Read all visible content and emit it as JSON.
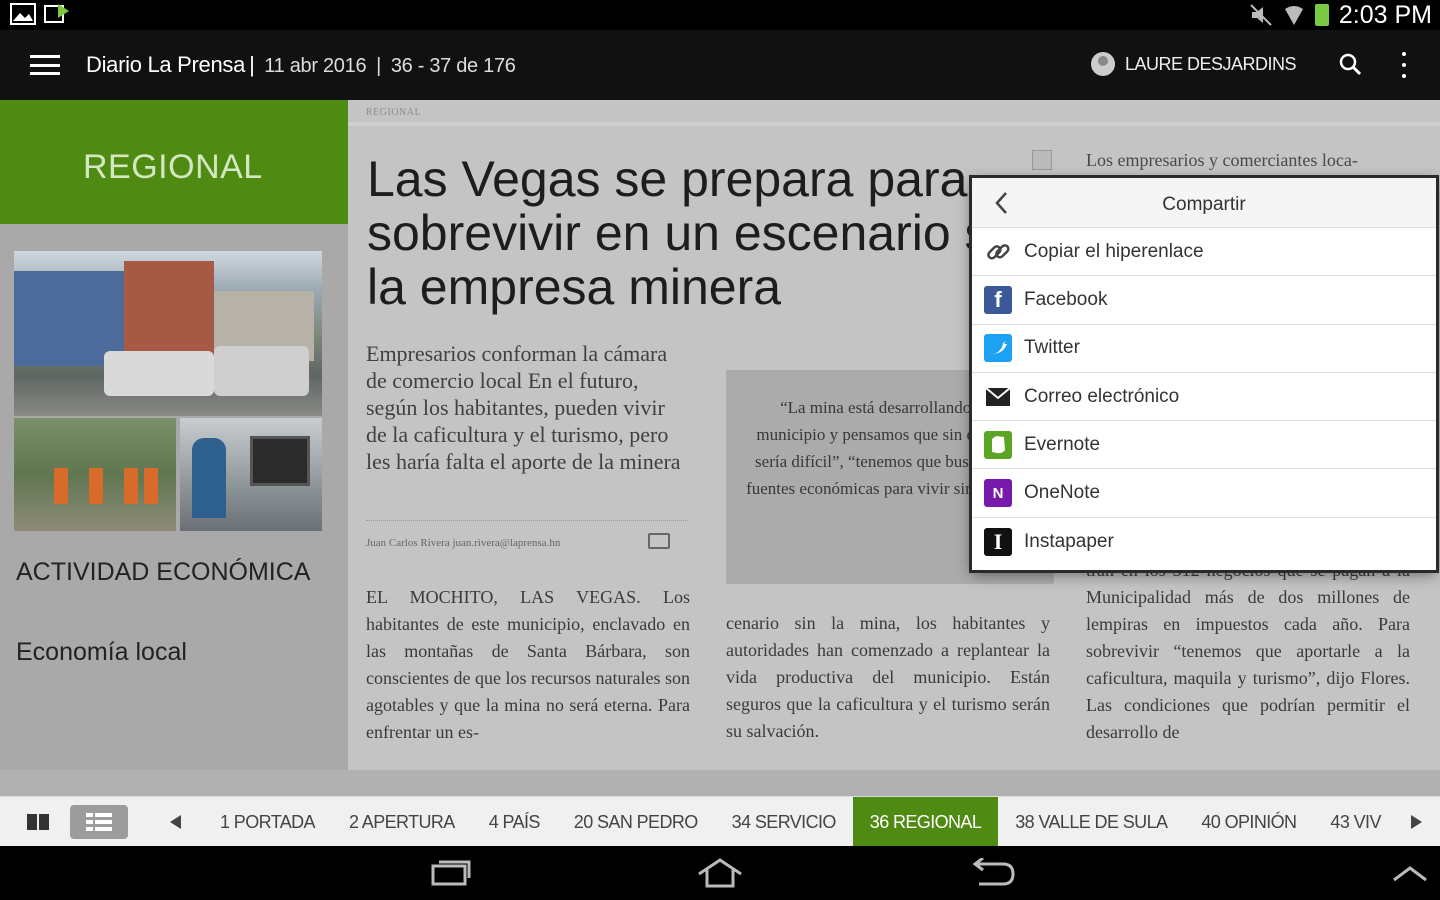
{
  "status_bar": {
    "time": "2:03 PM",
    "icons": [
      "gallery-icon",
      "download-icon",
      "mute-icon",
      "wifi-icon",
      "battery-icon"
    ]
  },
  "app_bar": {
    "publication": "Diario La Prensa",
    "separator": "|",
    "date": "11 abr 2016",
    "pages": "36 - 37 de 176",
    "user_name": "LAURE DESJARDINS"
  },
  "left_panel": {
    "section": "REGIONAL",
    "topic_1": "ACTIVIDAD ECONÓMICA",
    "topic_2": "Economía local"
  },
  "article": {
    "page_tag": "REGIONAL",
    "headline": "Las Vegas se prepara para sobrevivir en un escenario sin la empresa minera",
    "dek": "Empresarios conforman la cámara de comercio local En el futuro, según los habitantes, pueden vivir de la caficultura y el turismo, pero les haría falta el aporte de la minera",
    "byline": "Juan Carlos Rivera juan.rivera@laprensa.hn",
    "body_col1": "EL MOCHITO, LAS VEGAS. Los habitantes de este municipio, enclavado en las montañas de Santa Bárbara, son conscientes de que los recursos naturales son agotables y que la mina no será eterna. Para enfrentar un es-",
    "quote": "“La mina está desarrollando este municipio y pensamos que sin ella todo sería difícil”, “tenemos que buscar otras fuentes económicas para vivir sin la mina”",
    "body_col2": "cenario sin la mina, los habitantes y autoridades han comenzado a replantear la vida productiva del municipio. Están seguros que la caficultura y el turismo serán su salvación.",
    "col3_top": "Los empresarios y comerciantes loca-",
    "body_col3": "tran en los 312 negocios que se pagan a la Municipalidad más de dos millones de lempiras en impuestos cada año. Para sobrevivir “tenemos que aportarle a la caficultura, maquila y turismo”, dijo Flores. Las condiciones que podrían permitir el desarrollo de"
  },
  "share_menu": {
    "title": "Compartir",
    "items": [
      {
        "label": "Copiar el hiperenlace",
        "icon": "link-icon"
      },
      {
        "label": "Facebook",
        "icon": "facebook-icon"
      },
      {
        "label": "Twitter",
        "icon": "twitter-icon"
      },
      {
        "label": "Correo electrónico",
        "icon": "email-icon"
      },
      {
        "label": "Evernote",
        "icon": "evernote-icon"
      },
      {
        "label": "OneNote",
        "icon": "onenote-icon"
      },
      {
        "label": "Instapaper",
        "icon": "instapaper-icon"
      }
    ]
  },
  "sections": {
    "active_index": 5,
    "tabs": [
      "1 PORTADA",
      "2 APERTURA",
      "4 PAÍS",
      "20 SAN PEDRO",
      "34 SERVICIO",
      "36 REGIONAL",
      "38 VALLE DE SULA",
      "40 OPINIÓN",
      "43 VIV"
    ]
  },
  "colors": {
    "accent_green": "#4f8a12",
    "facebook": "#3b5998",
    "twitter": "#1da1f2",
    "evernote": "#5ba525",
    "onenote": "#7719aa"
  }
}
